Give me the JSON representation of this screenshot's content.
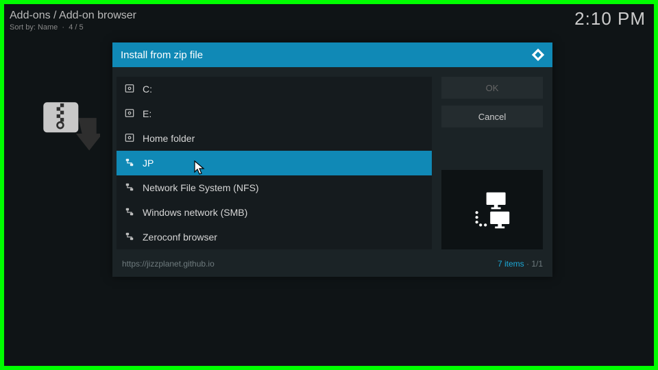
{
  "header": {
    "title": "Add-ons / Add-on browser",
    "sort_label": "Sort by: Name",
    "position": "4 / 5"
  },
  "clock": "2:10 PM",
  "dialog": {
    "title": "Install from zip file",
    "ok_label": "OK",
    "cancel_label": "Cancel",
    "footer_url": "https://jizzplanet.github.io",
    "item_count_label": "7 items",
    "page_label": "1/1"
  },
  "file_items": [
    {
      "label": "C:",
      "icon": "disk",
      "selected": false
    },
    {
      "label": "E:",
      "icon": "disk",
      "selected": false
    },
    {
      "label": "Home folder",
      "icon": "disk",
      "selected": false
    },
    {
      "label": "JP",
      "icon": "net",
      "selected": true
    },
    {
      "label": "Network File System (NFS)",
      "icon": "net",
      "selected": false
    },
    {
      "label": "Windows network (SMB)",
      "icon": "net",
      "selected": false
    },
    {
      "label": "Zeroconf browser",
      "icon": "net",
      "selected": false
    }
  ]
}
